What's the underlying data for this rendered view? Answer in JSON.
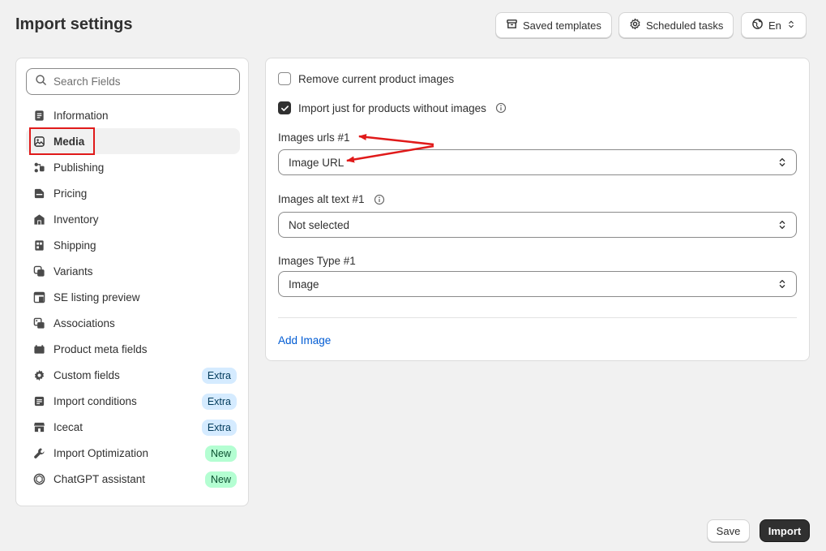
{
  "header": {
    "title": "Import settings",
    "saved_templates": "Saved templates",
    "scheduled_tasks": "Scheduled tasks",
    "language": "En"
  },
  "sidebar": {
    "search_placeholder": "Search Fields",
    "items": [
      {
        "label": "Information",
        "icon": "document-icon"
      },
      {
        "label": "Media",
        "icon": "image-icon",
        "active": true
      },
      {
        "label": "Publishing",
        "icon": "publishing-icon"
      },
      {
        "label": "Pricing",
        "icon": "price-tag-icon"
      },
      {
        "label": "Inventory",
        "icon": "inventory-icon"
      },
      {
        "label": "Shipping",
        "icon": "shipping-icon"
      },
      {
        "label": "Variants",
        "icon": "variants-icon"
      },
      {
        "label": "SE listing preview",
        "icon": "listing-preview-icon"
      },
      {
        "label": "Associations",
        "icon": "associations-icon"
      },
      {
        "label": "Product meta fields",
        "icon": "meta-fields-icon"
      },
      {
        "label": "Custom fields",
        "icon": "gear-icon",
        "badge": "Extra"
      },
      {
        "label": "Import conditions",
        "icon": "conditions-icon",
        "badge": "Extra"
      },
      {
        "label": "Icecat",
        "icon": "store-icon",
        "badge": "Extra"
      },
      {
        "label": "Import Optimization",
        "icon": "wrench-icon",
        "badge": "New"
      },
      {
        "label": "ChatGPT assistant",
        "icon": "chatgpt-icon",
        "badge": "New"
      }
    ]
  },
  "main": {
    "remove_images_label": "Remove current product images",
    "remove_images_checked": false,
    "import_without_images_label": "Import just for products without images",
    "import_without_images_checked": true,
    "images_urls_label": "Images urls #1",
    "images_urls_value": "Image URL",
    "images_alt_label": "Images alt text #1",
    "images_alt_value": "Not selected",
    "images_type_label": "Images Type #1",
    "images_type_value": "Image",
    "add_image_label": "Add Image"
  },
  "footer": {
    "save_label": "Save",
    "import_label": "Import"
  },
  "colors": {
    "accent_link": "#005bd3",
    "annotation_red": "#e01a1a",
    "primary_button": "#303030",
    "badge_extra_bg": "#d5ebff",
    "badge_new_bg": "#b4fed2"
  }
}
